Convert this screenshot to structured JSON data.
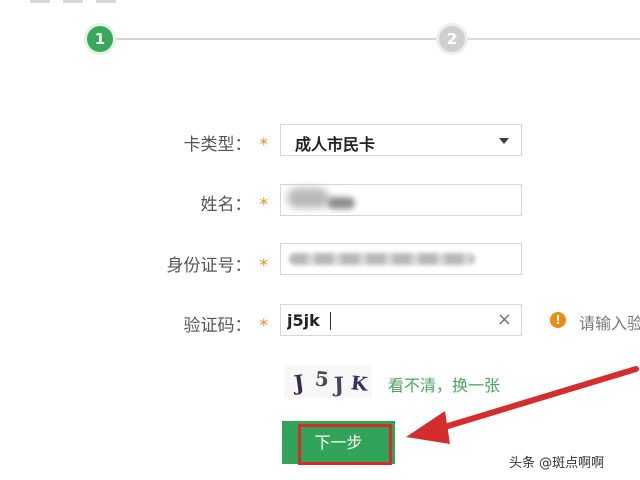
{
  "steps": [
    "1",
    "2"
  ],
  "form": {
    "card_type_label": "卡类型：",
    "card_type_value": "成人市民卡",
    "name_label": "姓名：",
    "id_label": "身份证号：",
    "captcha_label": "验证码：",
    "captcha_value": "j5jk",
    "required_mark": "*"
  },
  "captcha": {
    "chars": [
      "J",
      "5",
      "J",
      "K"
    ],
    "refresh_text": "看不清，换一张"
  },
  "hint": {
    "text": "请输入验"
  },
  "buttons": {
    "next_label": "下一步"
  },
  "watermark": "头条 @斑点啊啊",
  "colors": {
    "primary": "#32a45a",
    "warning": "#ef8a12",
    "highlight": "#d52d2d"
  }
}
